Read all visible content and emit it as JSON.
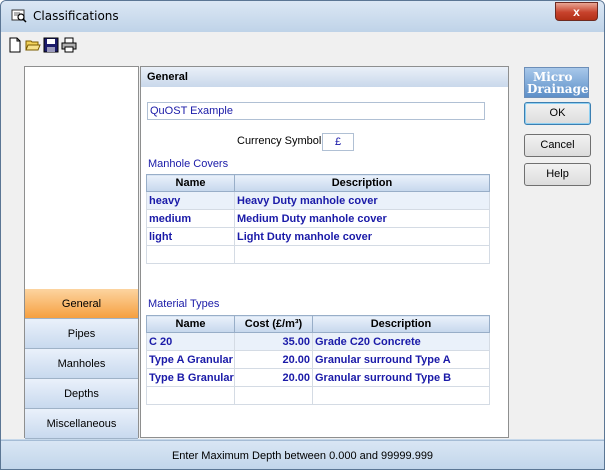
{
  "window": {
    "title": "Classifications",
    "close_label": "x",
    "title_icon": "magnifier-document-icon"
  },
  "toolbar": {
    "icons": [
      "new-document-icon",
      "open-folder-icon",
      "save-icon",
      "print-icon"
    ]
  },
  "nav": {
    "items": [
      {
        "label": "General",
        "active": true
      },
      {
        "label": "Pipes",
        "active": false
      },
      {
        "label": "Manholes",
        "active": false
      },
      {
        "label": "Depths",
        "active": false
      },
      {
        "label": "Miscellaneous",
        "active": false
      }
    ]
  },
  "general": {
    "header": "General",
    "project_name": "QuOST Example",
    "currency_label": "Currency Symbol",
    "currency_value": "£"
  },
  "manhole_covers": {
    "caption": "Manhole Covers",
    "columns": [
      "Name",
      "Description"
    ],
    "rows": [
      {
        "name": "heavy",
        "description": "Heavy Duty manhole cover"
      },
      {
        "name": "medium",
        "description": "Medium Duty manhole cover"
      },
      {
        "name": "light",
        "description": "Light Duty manhole cover"
      }
    ]
  },
  "material_types": {
    "caption": "Material Types",
    "columns": [
      "Name",
      "Cost (£/m³)",
      "Description"
    ],
    "rows": [
      {
        "name": "C 20",
        "cost": "35.00",
        "description": "Grade C20 Concrete"
      },
      {
        "name": "Type A Granular",
        "cost": "20.00",
        "description": "Granular surround Type A"
      },
      {
        "name": "Type B Granular",
        "cost": "20.00",
        "description": "Granular surround Type B"
      }
    ]
  },
  "logo": {
    "line1": "Micro",
    "line2": "Drainage"
  },
  "buttons": {
    "ok": "OK",
    "cancel": "Cancel",
    "help": "Help"
  },
  "status": {
    "text": "Enter Maximum Depth between 0.000 and 99999.999"
  },
  "colors": {
    "accent": "#1a1aa8",
    "active_nav": "#f6a040",
    "close": "#c7422c"
  }
}
